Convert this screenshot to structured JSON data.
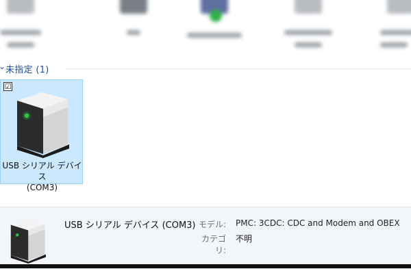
{
  "group": {
    "label": "未指定 (1)",
    "chevron_icon": "chevron-down-icon"
  },
  "device": {
    "name_line1": "USB シリアル デバイス",
    "name_line2": "(COM3)",
    "checked": true,
    "check_mark": "☑",
    "icon": "tower-computer-icon",
    "indicator_color": "#2ecc40"
  },
  "details": {
    "title": "USB シリアル デバイス (COM3)",
    "model_key": "モデル:",
    "model_value": "PMC: 3CDC: CDC and Modem and OBEX",
    "category_key": "カテゴリ:",
    "category_value": "不明"
  },
  "colors": {
    "selection_bg": "#cce8ff",
    "selection_border": "#99d1ff",
    "group_header": "#1e4f9c"
  }
}
